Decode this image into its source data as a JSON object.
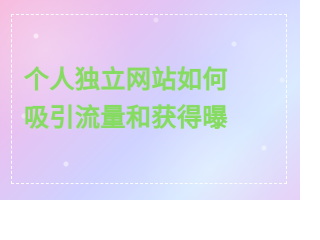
{
  "content": {
    "line_1": "个人独立网站如何",
    "line_2": "吸引流量和获得曝"
  },
  "style": {
    "text_color": "#86db61",
    "frame_color": "#ffffff",
    "background_colors": [
      "#f7b7dc",
      "#e8c1f1",
      "#cfd2ff",
      "#d8e9ff",
      "#e7d1f7"
    ]
  }
}
